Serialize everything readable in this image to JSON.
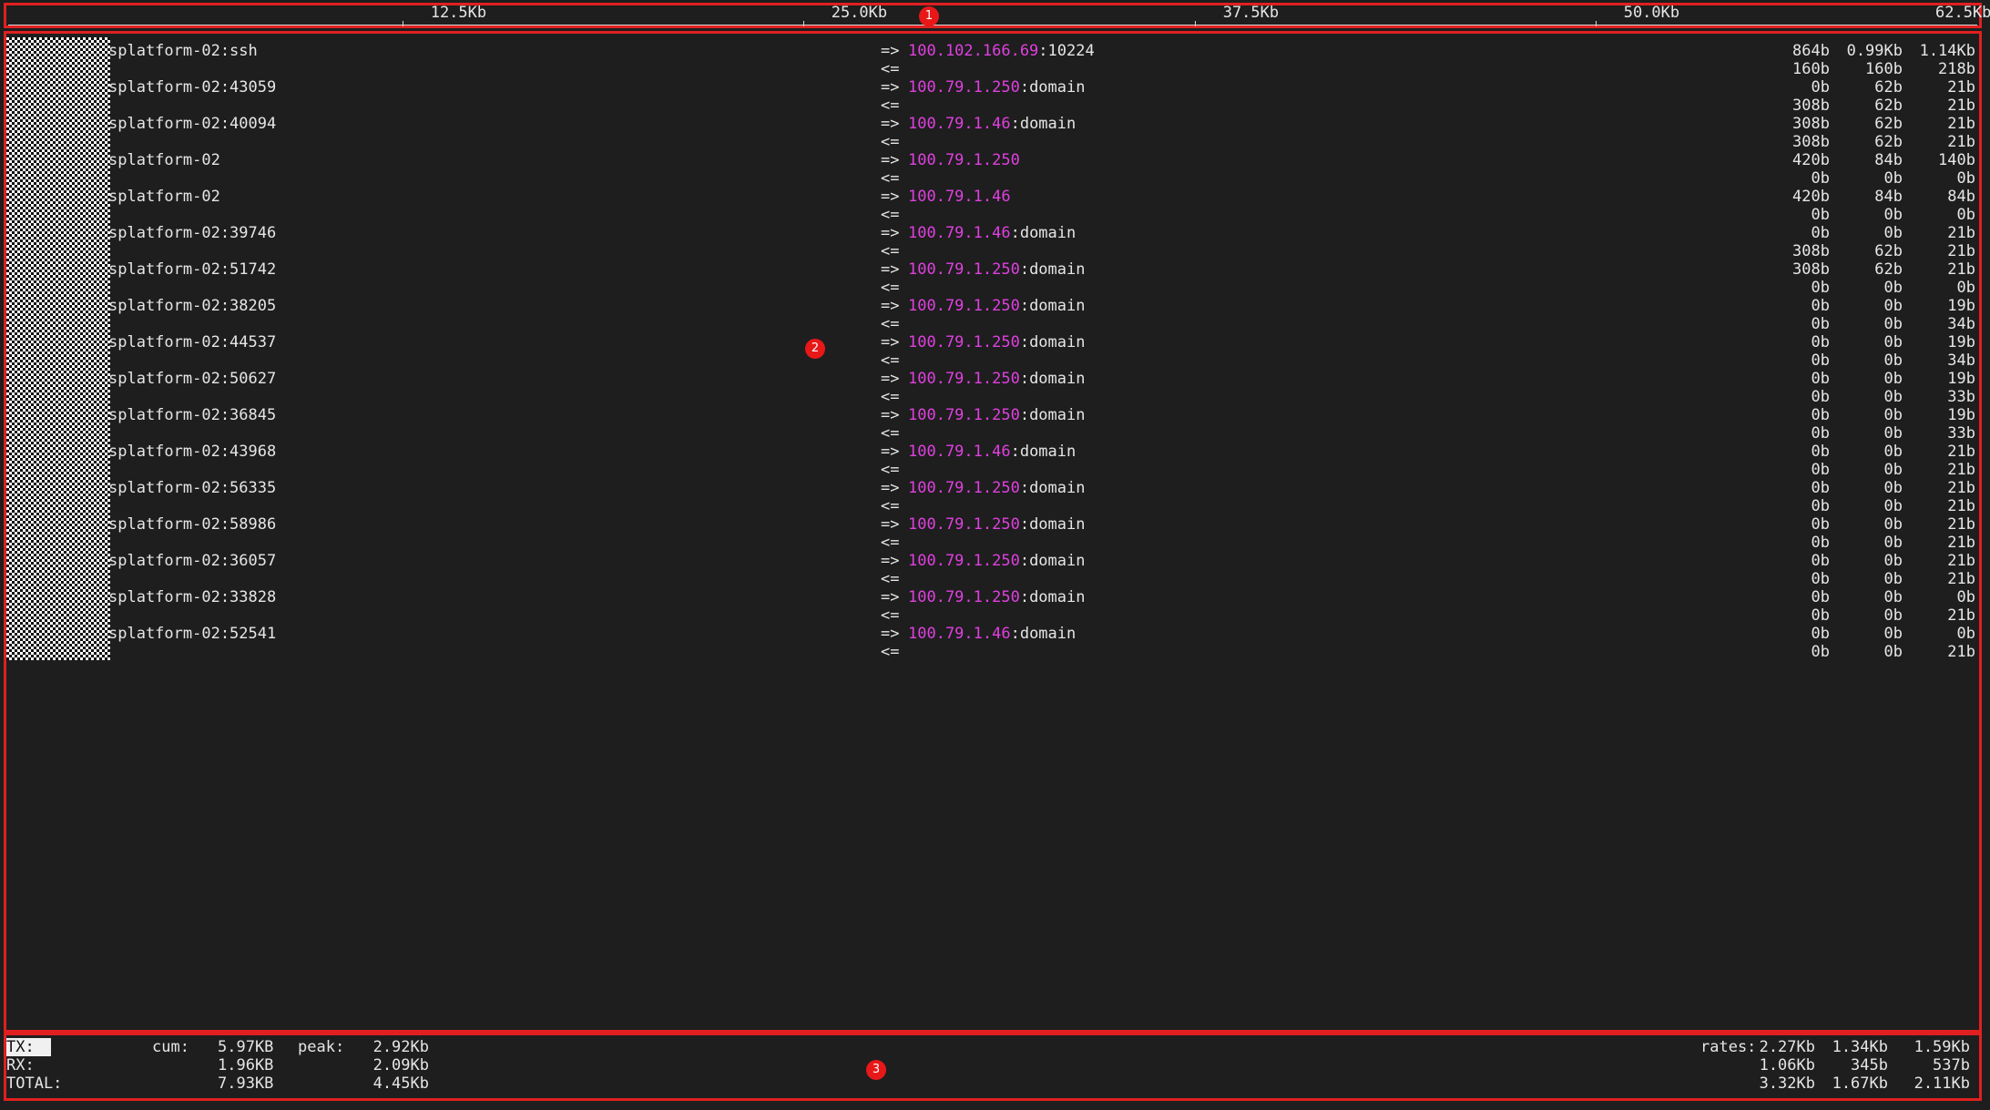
{
  "scale": {
    "ticks": [
      "12.5Kb",
      "25.0Kb",
      "37.5Kb",
      "50.0Kb",
      "62.5Kb"
    ]
  },
  "flows": [
    {
      "src": "splatform-02:ssh",
      "tx": "=>",
      "rx": "<=",
      "dst_host": "100.102.166.69",
      "dst_port": ":10224",
      "tx_rates": [
        "864b",
        "0.99Kb",
        "1.14Kb"
      ],
      "rx_rates": [
        "160b",
        "160b",
        "218b"
      ]
    },
    {
      "src": "splatform-02:43059",
      "tx": "=>",
      "rx": "<=",
      "dst_host": "100.79.1.250",
      "dst_port": ":domain",
      "tx_rates": [
        "0b",
        "62b",
        "21b"
      ],
      "rx_rates": [
        "308b",
        "62b",
        "21b"
      ]
    },
    {
      "src": "splatform-02:40094",
      "tx": "=>",
      "rx": "<=",
      "dst_host": "100.79.1.46",
      "dst_port": ":domain",
      "tx_rates": [
        "308b",
        "62b",
        "21b"
      ],
      "rx_rates": [
        "308b",
        "62b",
        "21b"
      ]
    },
    {
      "src": "splatform-02",
      "tx": "=>",
      "rx": "<=",
      "dst_host": "100.79.1.250",
      "dst_port": "",
      "tx_rates": [
        "420b",
        "84b",
        "140b"
      ],
      "rx_rates": [
        "0b",
        "0b",
        "0b"
      ]
    },
    {
      "src": "splatform-02",
      "tx": "=>",
      "rx": "<=",
      "dst_host": "100.79.1.46",
      "dst_port": "",
      "tx_rates": [
        "420b",
        "84b",
        "84b"
      ],
      "rx_rates": [
        "0b",
        "0b",
        "0b"
      ]
    },
    {
      "src": "splatform-02:39746",
      "tx": "=>",
      "rx": "<=",
      "dst_host": "100.79.1.46",
      "dst_port": ":domain",
      "tx_rates": [
        "0b",
        "0b",
        "21b"
      ],
      "rx_rates": [
        "308b",
        "62b",
        "21b"
      ]
    },
    {
      "src": "splatform-02:51742",
      "tx": "=>",
      "rx": "<=",
      "dst_host": "100.79.1.250",
      "dst_port": ":domain",
      "tx_rates": [
        "308b",
        "62b",
        "21b"
      ],
      "rx_rates": [
        "0b",
        "0b",
        "0b"
      ]
    },
    {
      "src": "splatform-02:38205",
      "tx": "=>",
      "rx": "<=",
      "dst_host": "100.79.1.250",
      "dst_port": ":domain",
      "tx_rates": [
        "0b",
        "0b",
        "19b"
      ],
      "rx_rates": [
        "0b",
        "0b",
        "34b"
      ]
    },
    {
      "src": "splatform-02:44537",
      "tx": "=>",
      "rx": "<=",
      "dst_host": "100.79.1.250",
      "dst_port": ":domain",
      "tx_rates": [
        "0b",
        "0b",
        "19b"
      ],
      "rx_rates": [
        "0b",
        "0b",
        "34b"
      ]
    },
    {
      "src": "splatform-02:50627",
      "tx": "=>",
      "rx": "<=",
      "dst_host": "100.79.1.250",
      "dst_port": ":domain",
      "tx_rates": [
        "0b",
        "0b",
        "19b"
      ],
      "rx_rates": [
        "0b",
        "0b",
        "33b"
      ]
    },
    {
      "src": "splatform-02:36845",
      "tx": "=>",
      "rx": "<=",
      "dst_host": "100.79.1.250",
      "dst_port": ":domain",
      "tx_rates": [
        "0b",
        "0b",
        "19b"
      ],
      "rx_rates": [
        "0b",
        "0b",
        "33b"
      ]
    },
    {
      "src": "splatform-02:43968",
      "tx": "=>",
      "rx": "<=",
      "dst_host": "100.79.1.46",
      "dst_port": ":domain",
      "tx_rates": [
        "0b",
        "0b",
        "21b"
      ],
      "rx_rates": [
        "0b",
        "0b",
        "21b"
      ]
    },
    {
      "src": "splatform-02:56335",
      "tx": "=>",
      "rx": "<=",
      "dst_host": "100.79.1.250",
      "dst_port": ":domain",
      "tx_rates": [
        "0b",
        "0b",
        "21b"
      ],
      "rx_rates": [
        "0b",
        "0b",
        "21b"
      ]
    },
    {
      "src": "splatform-02:58986",
      "tx": "=>",
      "rx": "<=",
      "dst_host": "100.79.1.250",
      "dst_port": ":domain",
      "tx_rates": [
        "0b",
        "0b",
        "21b"
      ],
      "rx_rates": [
        "0b",
        "0b",
        "21b"
      ]
    },
    {
      "src": "splatform-02:36057",
      "tx": "=>",
      "rx": "<=",
      "dst_host": "100.79.1.250",
      "dst_port": ":domain",
      "tx_rates": [
        "0b",
        "0b",
        "21b"
      ],
      "rx_rates": [
        "0b",
        "0b",
        "21b"
      ]
    },
    {
      "src": "splatform-02:33828",
      "tx": "=>",
      "rx": "<=",
      "dst_host": "100.79.1.250",
      "dst_port": ":domain",
      "tx_rates": [
        "0b",
        "0b",
        "0b"
      ],
      "rx_rates": [
        "0b",
        "0b",
        "21b"
      ]
    },
    {
      "src": "splatform-02:52541",
      "tx": "=>",
      "rx": "<=",
      "dst_host": "100.79.1.46",
      "dst_port": ":domain",
      "tx_rates": [
        "0b",
        "0b",
        "0b"
      ],
      "rx_rates": [
        "0b",
        "0b",
        "21b"
      ]
    }
  ],
  "totals": {
    "tx_label": "TX:",
    "rx_label": "RX:",
    "total_label": "TOTAL:",
    "cum_label": "cum:",
    "peak_label": "peak:",
    "rates_label": "rates:",
    "tx_cum": "5.97KB",
    "rx_cum": "1.96KB",
    "total_cum": "7.93KB",
    "tx_peak": "2.92Kb",
    "rx_peak": "2.09Kb",
    "total_peak": "4.45Kb",
    "tx_rates": [
      "2.27Kb",
      "1.34Kb",
      "1.59Kb"
    ],
    "rx_rates": [
      "1.06Kb",
      "345b",
      "537b"
    ],
    "total_rates": [
      "3.32Kb",
      "1.67Kb",
      "2.11Kb"
    ]
  },
  "markers": [
    "1",
    "2",
    "3"
  ],
  "colors": {
    "background": "#1e1e1e",
    "foreground": "#e6e6e6",
    "host": "#e040e0",
    "region_border": "#e02020",
    "marker": "#e81818"
  }
}
